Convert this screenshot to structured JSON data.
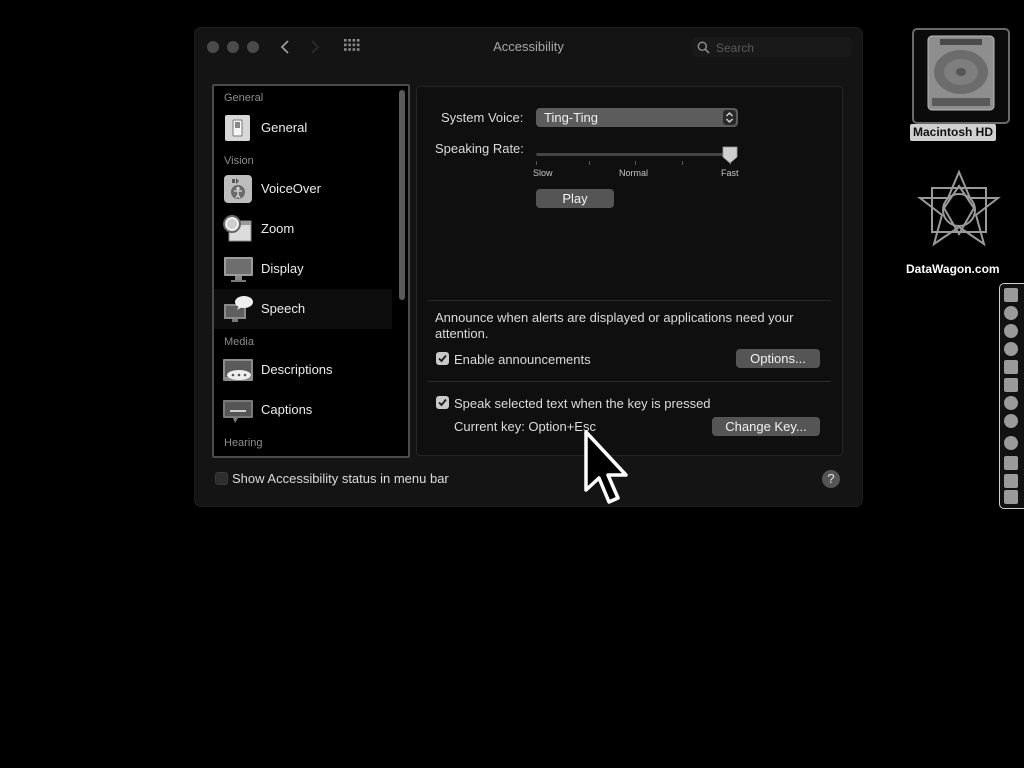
{
  "window": {
    "title": "Accessibility",
    "search_placeholder": "Search"
  },
  "sidebar": {
    "sections": {
      "general": "General",
      "vision": "Vision",
      "media": "Media",
      "hearing": "Hearing"
    },
    "items": [
      {
        "label": "General",
        "icon": "switch-icon"
      },
      {
        "label": "VoiceOver",
        "icon": "voiceover-icon"
      },
      {
        "label": "Zoom",
        "icon": "zoom-icon"
      },
      {
        "label": "Display",
        "icon": "display-icon"
      },
      {
        "label": "Speech",
        "icon": "speech-icon",
        "selected": true
      },
      {
        "label": "Descriptions",
        "icon": "descriptions-icon"
      },
      {
        "label": "Captions",
        "icon": "captions-icon"
      }
    ]
  },
  "speech": {
    "system_voice_label": "System Voice:",
    "system_voice_value": "Ting-Ting",
    "speaking_rate_label": "Speaking Rate:",
    "rate_labels": {
      "slow": "Slow",
      "normal": "Normal",
      "fast": "Fast"
    },
    "rate_value": 1.0,
    "play_label": "Play",
    "announce_text": "Announce when alerts are displayed or applications need your attention.",
    "enable_announcements_label": "Enable announcements",
    "enable_announcements_checked": true,
    "options_label": "Options...",
    "speak_selected_label": "Speak selected text when the key is pressed",
    "speak_selected_checked": true,
    "current_key_label": "Current key: Option+Esc",
    "change_key_label": "Change Key..."
  },
  "footer": {
    "show_status_label": "Show Accessibility status in menu bar",
    "show_status_checked": false,
    "help_label": "?"
  },
  "desktop": {
    "hd_label": "Macintosh HD",
    "app_label": "DataWagon.com"
  }
}
